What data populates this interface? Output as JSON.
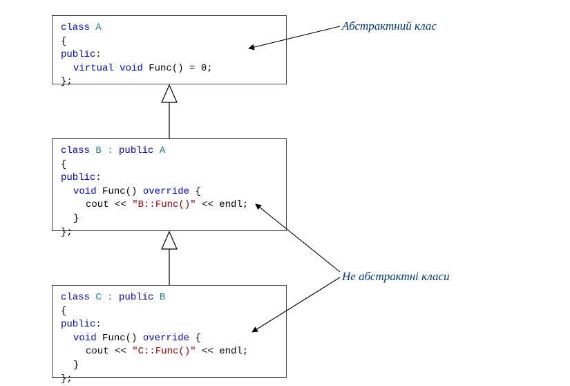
{
  "notes": {
    "abstract_label": "Абстрактний клас",
    "non_abstract_label": "Не абстрактні класи"
  },
  "boxes": {
    "A": {
      "l1_kw_class": "class",
      "l1_name": " A",
      "l2": "{",
      "l3_kw": "public",
      "l3_colon": ":",
      "l4_kw_virtual": "virtual",
      "l4_sp1": " ",
      "l4_kw_void": "void",
      "l4_rest": " Func() = 0;",
      "l5": "};"
    },
    "B": {
      "l1_kw_class": "class",
      "l1_mid": " B : ",
      "l1_kw_public": "public",
      "l1_base": " A",
      "l2": "{",
      "l3_kw": "public",
      "l3_colon": ":",
      "l4_kw_void": "void",
      "l4_sig": " Func() ",
      "l4_kw_override": "override",
      "l4_brace": " {",
      "l5a": "cout << ",
      "l5_str": "\"B::Func()\"",
      "l5b": " << endl;",
      "l6": "}",
      "l7": "};"
    },
    "C": {
      "l1_kw_class": "class",
      "l1_mid": " C : ",
      "l1_kw_public": "public",
      "l1_base": " B",
      "l2": "{",
      "l3_kw": "public",
      "l3_colon": ":",
      "l4_kw_void": "void",
      "l4_sig": " Func() ",
      "l4_kw_override": "override",
      "l4_brace": " {",
      "l5a": "cout << ",
      "l5_str": "\"C::Func()\"",
      "l5b": " << endl;",
      "l6": "}",
      "l7": "};"
    }
  }
}
